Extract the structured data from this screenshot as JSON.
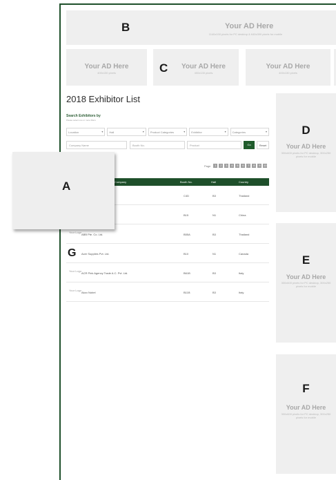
{
  "labels": {
    "a": "A",
    "b": "B",
    "c": "C",
    "d": "D",
    "e": "E",
    "f": "F",
    "g": "G"
  },
  "ads": {
    "title": "Your AD Here",
    "b_sub": "1140x100 pixels for PC desktop & 640x300 pixels for mobile",
    "small_sub": "400x130 pixels",
    "side_sub": "300x600 pixels for PC desktop, 300x250 pixels for mobile"
  },
  "page_title": "2018 Exhibitor List",
  "search": {
    "heading": "Search Exhibitors by",
    "sub": "Please select one or more filters",
    "filters": [
      {
        "label": "Location"
      },
      {
        "label": "Hall"
      },
      {
        "label": "Product Categories"
      },
      {
        "label": "Exhibitor"
      },
      {
        "label": "Categories"
      }
    ],
    "company_placeholder": "Company Name",
    "booth_placeholder": "Booth No.",
    "product_placeholder": "Product",
    "go_label": "Go",
    "reset_label": "Reset"
  },
  "pager": {
    "label": "Page",
    "pages": [
      "1",
      "2",
      "3",
      "4",
      "5",
      "6",
      "7",
      "8",
      "9",
      "10"
    ]
  },
  "table": {
    "columns": [
      "Company",
      "Booth No.",
      "Hall",
      "Country"
    ],
    "rows": [
      {
        "logo": "",
        "company": "",
        "booth": "C4D",
        "hall": "B3",
        "country": "Thailand"
      },
      {
        "logo": "",
        "company": "",
        "booth": "B15",
        "hall": "N1",
        "country": "China"
      },
      {
        "logo": "Your Logo",
        "company": "ABB Pte. Co. Ltd.",
        "booth": "B55A",
        "hall": "B3",
        "country": "Thailand"
      },
      {
        "logo": "",
        "company": "Acer Supplies Pvt. Ltd.",
        "booth": "B10",
        "hall": "N1",
        "country": "Canada"
      },
      {
        "logo": "Your Logo",
        "company": "ACR Pink Agency Trade A.C. Pvt. Ltd.",
        "booth": "B61B",
        "hall": "B3",
        "country": "Italy"
      },
      {
        "logo": "Your Logo",
        "company": "Akzo Nobel",
        "booth": "B11B",
        "hall": "B3",
        "country": "Italy"
      }
    ]
  }
}
